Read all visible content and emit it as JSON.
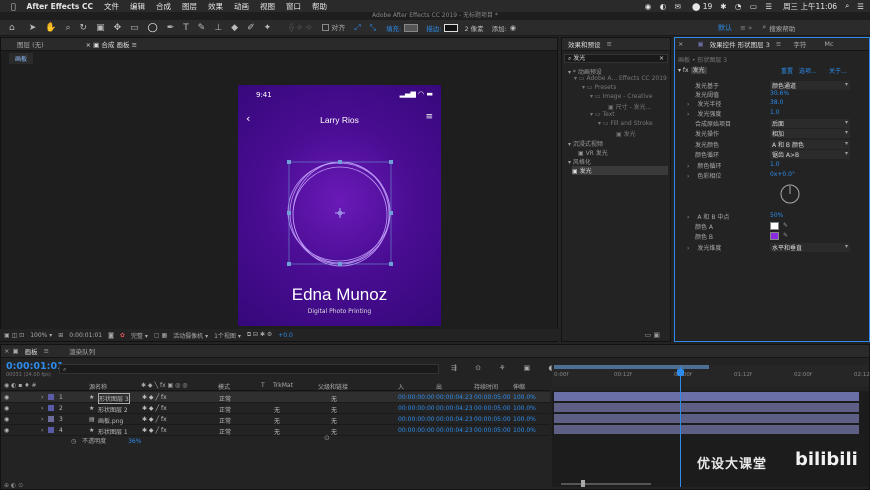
{
  "menubar": {
    "apple": "",
    "app": "After Effects CC",
    "items": [
      "文件",
      "编辑",
      "合成",
      "图层",
      "效果",
      "动画",
      "视图",
      "窗口",
      "帮助"
    ],
    "battery": "19",
    "clock": "周三 上午11:06"
  },
  "titlebar": "Adobe After Effects CC 2019 - 无标题项目 *",
  "toolbar": {
    "align_label": "对齐",
    "fill_label": "填充:",
    "stroke_label": "描边:",
    "stroke_width": "2 像素",
    "add_label": "添加:",
    "workspace": "默认",
    "search_help": "搜索帮助"
  },
  "left_panel": {
    "tabs": [
      "图层 (无)",
      "合成 画板"
    ],
    "subtab": "画板"
  },
  "phone": {
    "time": "9:41",
    "header_name": "Larry Rios",
    "name": "Edna Munoz",
    "role": "Digital Photo Printing"
  },
  "viewer_bar": {
    "zoom": "100%",
    "timecode": "0:00:01:01",
    "quality": "完整",
    "camera": "活动摄像机",
    "views": "1个视图",
    "offset": "+0.0"
  },
  "effects_panel": {
    "title": "效果和预设",
    "search": "发光",
    "tree": [
      "* 动画预设",
      "Adobe A... Effects CC 2019",
      "Presets",
      "Image - Creative",
      "尺寸 - 发光...",
      "Text",
      "Fill and Stroke",
      "发光",
      "沉浸式视频",
      "VR 发光",
      "风格化",
      "发光"
    ]
  },
  "controls_panel": {
    "title": "效果控件 形状图层 3",
    "tab2": "字符",
    "tab3": "Mc",
    "breadcrumb": "画板 • 形状图层 3",
    "effect_name": "发光",
    "links": [
      "重置",
      "选项...",
      "关于..."
    ],
    "props": [
      {
        "name": "发光基于",
        "value": "颜色通道"
      },
      {
        "name": "发光阈值",
        "value": "30.6%"
      },
      {
        "name": "发光半径",
        "value": "38.0"
      },
      {
        "name": "发光强度",
        "value": "1.0"
      },
      {
        "name": "合成原始项目",
        "value": "后面"
      },
      {
        "name": "发光操作",
        "value": "相加"
      },
      {
        "name": "发光颜色",
        "value": "A 和 B 颜色"
      },
      {
        "name": "颜色循环",
        "value": "锯齿 A>B"
      },
      {
        "name": "颜色循环",
        "value": "1.0"
      },
      {
        "name": "色彩相位",
        "value": "0x+0.0°"
      },
      {
        "name": "A 和 B 中点",
        "value": "50%"
      },
      {
        "name": "颜色 A",
        "value": ""
      },
      {
        "name": "颜色 B",
        "value": ""
      },
      {
        "name": "发光维度",
        "value": "水平和垂直"
      }
    ],
    "color_a": "#ffffff",
    "color_b": "#8a2be2"
  },
  "timeline": {
    "tab": "画板",
    "tab2": "渲染队列",
    "timecode": "0:00:01:01",
    "frames": "00031 (24.00 fps)",
    "headers": [
      "源名称",
      "模式",
      "T",
      "TrkMat",
      "父级和链接",
      "入",
      "出",
      "持续时间",
      "伸缩"
    ],
    "ruler": [
      "0:00f",
      "00:12f",
      "01:00f",
      "01:12f",
      "02:00f",
      "02:12f"
    ],
    "layers": [
      {
        "num": "1",
        "name": "形状图层 3",
        "mode": "正常",
        "trk": "",
        "parent": "无",
        "in": "00:00:00:00",
        "out": "00:00:04:23",
        "dur": "00:00:05:00",
        "stretch": "100.0%"
      },
      {
        "num": "2",
        "name": "形状图层 2",
        "mode": "正常",
        "trk": "无",
        "parent": "无",
        "in": "00:00:00:00",
        "out": "00:00:04:23",
        "dur": "00:00:05:00",
        "stretch": "100.0%"
      },
      {
        "num": "3",
        "name": "画板.png",
        "mode": "正常",
        "trk": "无",
        "parent": "无",
        "in": "00:00:00:00",
        "out": "00:00:04:23",
        "dur": "00:00:05:00",
        "stretch": "100.0%"
      },
      {
        "num": "4",
        "name": "形状图层 1",
        "mode": "正常",
        "trk": "无",
        "parent": "无",
        "in": "00:00:00:00",
        "out": "00:00:04:23",
        "dur": "00:00:05:00",
        "stretch": "100.0%"
      }
    ],
    "opacity_label": "不透明度",
    "opacity_value": "36%"
  },
  "watermark": {
    "text": "优设大课堂",
    "logo": "bilibili"
  }
}
